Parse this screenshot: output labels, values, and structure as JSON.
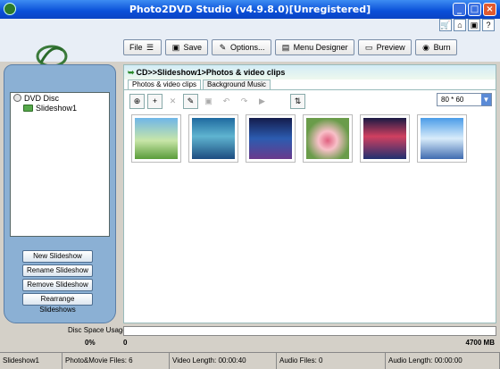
{
  "window": {
    "title": "Photo2DVD Studio (v4.9.8.0)[Unregistered]",
    "min": "_",
    "max": "□",
    "close": "×"
  },
  "quickbar": [
    "🛒",
    "⌂",
    "▣",
    "?"
  ],
  "toolbar": {
    "file": "File",
    "save": "Save",
    "options": "Options...",
    "menu_designer": "Menu Designer",
    "preview": "Preview",
    "burn": "Burn"
  },
  "tree": {
    "root": "DVD Disc",
    "child": "Slideshow1"
  },
  "left_buttons": {
    "new": "New Slideshow",
    "rename": "Rename Slideshow",
    "remove": "Remove Slideshow",
    "rearrange": "Rearrange Slideshows"
  },
  "path": "CD>>Slideshow1>Photos & video clips",
  "tabs": {
    "photos": "Photos & video clips",
    "music": "Background Music"
  },
  "zoom": {
    "value": "80 * 60"
  },
  "disc": {
    "label": "Disc Space Usage",
    "percent": "0%",
    "min": "0",
    "max": "4700 MB",
    "fill": 0.0
  },
  "status": {
    "slideshow": "Slideshow1",
    "files": "Photo&Movie Files: 6",
    "video_length": "Video Length: 00:00:40",
    "audio_files": "Audio Files: 0",
    "audio_length": "Audio Length: 00:00:00"
  },
  "colors": {
    "accent": "#0a4fd8",
    "panel": "#8bb0d4"
  }
}
